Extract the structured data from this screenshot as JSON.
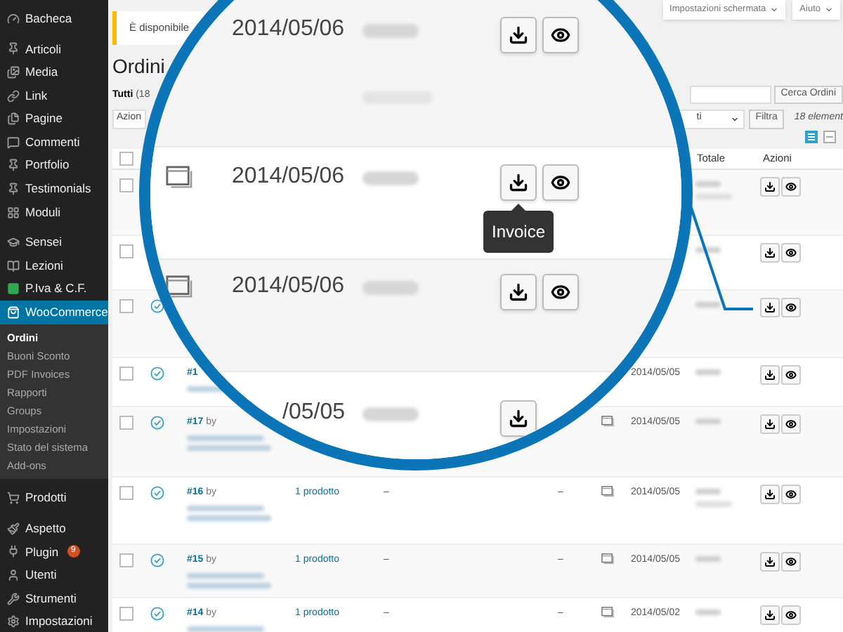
{
  "sidebar": {
    "groups": [
      {
        "items": [
          {
            "label": "Bacheca",
            "selected": false
          }
        ]
      },
      {
        "items": [
          {
            "label": "Articoli",
            "selected": false
          },
          {
            "label": "Media",
            "selected": false
          },
          {
            "label": "Link",
            "selected": false
          },
          {
            "label": "Pagine",
            "selected": false
          },
          {
            "label": "Commenti",
            "selected": false
          },
          {
            "label": "Portfolio",
            "selected": false
          },
          {
            "label": "Testimonials",
            "selected": false
          },
          {
            "label": "Moduli",
            "selected": false
          }
        ]
      },
      {
        "items": [
          {
            "label": "Sensei",
            "selected": false
          },
          {
            "label": "Lezioni",
            "selected": false
          },
          {
            "label": "P.Iva & C.F.",
            "selected": false
          },
          {
            "label": "WooCommerce",
            "selected": true,
            "children": [
              {
                "label": "Ordini",
                "selected": true
              },
              {
                "label": "Buoni Sconto",
                "selected": false
              },
              {
                "label": "PDF Invoices",
                "selected": false
              },
              {
                "label": "Rapporti",
                "selected": false
              },
              {
                "label": "Groups",
                "selected": false
              },
              {
                "label": "Impostazioni",
                "selected": false
              },
              {
                "label": "Stato del sistema",
                "selected": false
              },
              {
                "label": "Add-ons",
                "selected": false
              }
            ]
          }
        ]
      },
      {
        "items": [
          {
            "label": "Prodotti",
            "selected": false
          }
        ]
      },
      {
        "items": [
          {
            "label": "Aspetto",
            "selected": false
          },
          {
            "label": "Plugin",
            "selected": false,
            "badge": "9"
          },
          {
            "label": "Utenti",
            "selected": false
          },
          {
            "label": "Strumenti",
            "selected": false
          },
          {
            "label": "Impostazioni",
            "selected": false
          }
        ]
      }
    ]
  },
  "header_buttons": [
    {
      "label": "Impostazioni schermata"
    },
    {
      "label": "Aiuto"
    }
  ],
  "notice": {
    "text": "È disponibile"
  },
  "page_title": "Ordini",
  "status_filter": {
    "label": "Tutti",
    "count": "(18"
  },
  "bulk_actions": {
    "value": "Azion"
  },
  "search": {
    "button": "Cerca Ordini"
  },
  "filter": {
    "value": "ti",
    "button": "Filtra"
  },
  "items_count": "18 element",
  "view_modes": [
    {
      "kind": "list",
      "selected": true
    },
    {
      "kind": "excerpt",
      "selected": false
    }
  ],
  "table": {
    "select_all": {
      "checked": false
    },
    "columns": [
      {
        "label": "Totale"
      },
      {
        "label": "Azioni"
      }
    ],
    "rows": [
      {
        "checked": false
      },
      {
        "checked": false
      },
      {
        "checked": false,
        "completed": true
      },
      {
        "checked": false,
        "completed": true,
        "order": "#1",
        "date": "2014/05/05"
      },
      {
        "checked": false,
        "completed": true,
        "order": "#17",
        "by": "by",
        "note": true,
        "date": "2014/05/05"
      },
      {
        "checked": false,
        "completed": true,
        "order": "#16",
        "by": "by",
        "items": "1 prodotto",
        "column_4": "–",
        "column_5": "–",
        "note": true,
        "date": "2014/05/05"
      },
      {
        "checked": false,
        "completed": true,
        "order": "#15",
        "by": "by",
        "items": "1 prodotto",
        "column_4": "–",
        "column_5": "–",
        "note": true,
        "date": "2014/05/05"
      },
      {
        "checked": false,
        "completed": true,
        "order": "#14",
        "by": "by",
        "items": "1 prodotto",
        "column_4": "–",
        "column_5": "–",
        "note": true,
        "date": "2014/05/02"
      }
    ]
  },
  "magnifier": {
    "rows": [
      {
        "date": "2014/05/06",
        "icon": false,
        "download": true,
        "preview": true
      },
      {
        "date": "2014/05/06",
        "icon": true,
        "download": true,
        "preview": true,
        "tooltip": "Invoice"
      },
      {
        "date": "2014/05/06",
        "icon": true,
        "download": true,
        "preview": true
      },
      {
        "date": "/05/05",
        "icon": false,
        "download": true,
        "preview": false
      }
    ]
  }
}
